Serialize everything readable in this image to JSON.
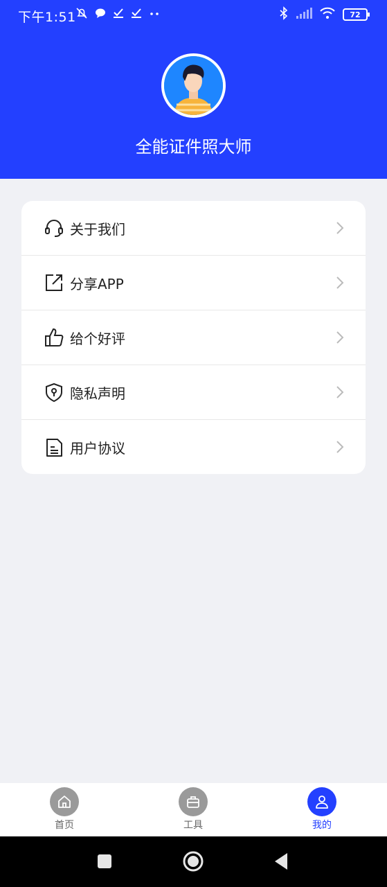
{
  "status_bar": {
    "time": "下午1:51",
    "battery": "72",
    "icons_left": [
      "mute-icon",
      "chat-icon",
      "check-icon",
      "check-icon",
      "more-dots-icon"
    ],
    "icons_right": [
      "bluetooth-icon",
      "signal-icon",
      "wifi-icon",
      "battery-icon"
    ]
  },
  "header": {
    "app_name": "全能证件照大师",
    "avatar": "user-avatar",
    "background_color": "#2340ff"
  },
  "menu": {
    "items": [
      {
        "label": "关于我们",
        "icon": "headset-icon"
      },
      {
        "label": "分享APP",
        "icon": "share-icon"
      },
      {
        "label": "给个好评",
        "icon": "thumbs-up-icon"
      },
      {
        "label": "隐私声明",
        "icon": "shield-lock-icon"
      },
      {
        "label": "用户协议",
        "icon": "document-icon"
      }
    ]
  },
  "tabbar": {
    "tabs": [
      {
        "label": "首页",
        "icon": "home-icon",
        "active": false
      },
      {
        "label": "工具",
        "icon": "toolbox-icon",
        "active": false
      },
      {
        "label": "我的",
        "icon": "profile-icon",
        "active": true
      }
    ],
    "active_color": "#2340ff"
  },
  "system_nav": {
    "buttons": [
      "recents-button",
      "home-button",
      "back-button"
    ]
  }
}
